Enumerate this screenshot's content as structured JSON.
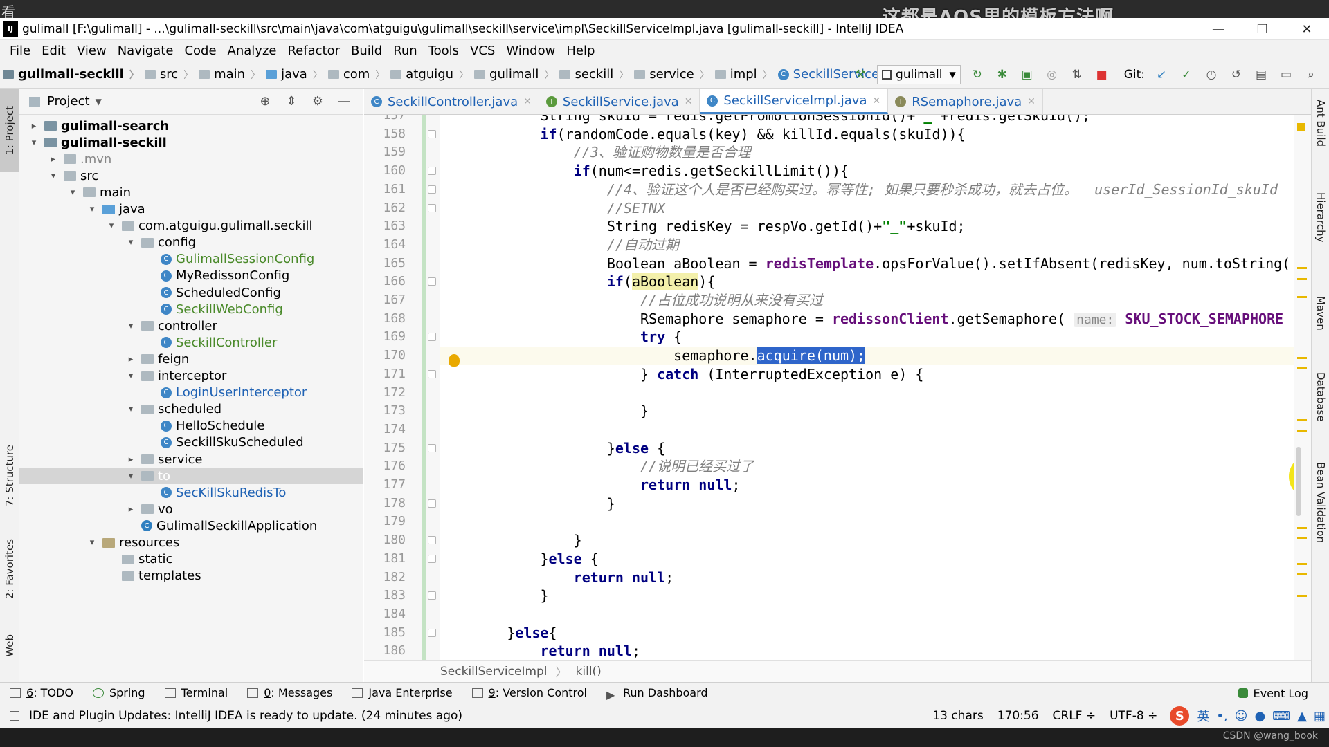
{
  "overlay": {
    "corner": "看",
    "caption": "这都是AQS里的模板方法啊"
  },
  "window": {
    "title": "gulimall [F:\\gulimall] - ...\\gulimall-seckill\\src\\main\\java\\com\\atguigu\\gulimall\\seckill\\service\\impl\\SeckillServiceImpl.java [gulimall-seckill] - IntelliJ IDEA",
    "logo": "IJ"
  },
  "menu": [
    "File",
    "Edit",
    "View",
    "Navigate",
    "Code",
    "Analyze",
    "Refactor",
    "Build",
    "Run",
    "Tools",
    "VCS",
    "Window",
    "Help"
  ],
  "breadcrumb": [
    "gulimall-seckill",
    "src",
    "main",
    "java",
    "com",
    "atguigu",
    "gulimall",
    "seckill",
    "service",
    "impl",
    "SeckillServiceImpl"
  ],
  "toolbar": {
    "run_config": "gulimall",
    "git_label": "Git:"
  },
  "project": {
    "title": "Project",
    "tree": [
      {
        "label": "gulimall-search",
        "level": 1,
        "arrow": "›",
        "type": "mod",
        "style": "bold"
      },
      {
        "label": "gulimall-seckill",
        "level": 1,
        "arrow": "⌄",
        "type": "mod",
        "style": "bold"
      },
      {
        "label": ".mvn",
        "level": 2,
        "arrow": "›",
        "type": "dir",
        "style": "gray"
      },
      {
        "label": "src",
        "level": 2,
        "arrow": "⌄",
        "type": "dir",
        "style": ""
      },
      {
        "label": "main",
        "level": 3,
        "arrow": "⌄",
        "type": "dir",
        "style": ""
      },
      {
        "label": "java",
        "level": 4,
        "arrow": "⌄",
        "type": "java",
        "style": ""
      },
      {
        "label": "com.atguigu.gulimall.seckill",
        "level": 5,
        "arrow": "⌄",
        "type": "dir",
        "style": ""
      },
      {
        "label": "config",
        "level": 6,
        "arrow": "⌄",
        "type": "dir",
        "style": ""
      },
      {
        "label": "GulimallSessionConfig",
        "level": 7,
        "arrow": "",
        "type": "class",
        "style": "green"
      },
      {
        "label": "MyRedissonConfig",
        "level": 7,
        "arrow": "",
        "type": "class",
        "style": ""
      },
      {
        "label": "ScheduledConfig",
        "level": 7,
        "arrow": "",
        "type": "class",
        "style": ""
      },
      {
        "label": "SeckillWebConfig",
        "level": 7,
        "arrow": "",
        "type": "class",
        "style": "green"
      },
      {
        "label": "controller",
        "level": 6,
        "arrow": "⌄",
        "type": "dir",
        "style": ""
      },
      {
        "label": "SeckillController",
        "level": 7,
        "arrow": "",
        "type": "class",
        "style": "green"
      },
      {
        "label": "feign",
        "level": 6,
        "arrow": "›",
        "type": "dir",
        "style": ""
      },
      {
        "label": "interceptor",
        "level": 6,
        "arrow": "⌄",
        "type": "dir",
        "style": ""
      },
      {
        "label": "LoginUserInterceptor",
        "level": 7,
        "arrow": "",
        "type": "class",
        "style": "blue"
      },
      {
        "label": "scheduled",
        "level": 6,
        "arrow": "⌄",
        "type": "dir",
        "style": ""
      },
      {
        "label": "HelloSchedule",
        "level": 7,
        "arrow": "",
        "type": "class",
        "style": ""
      },
      {
        "label": "SeckillSkuScheduled",
        "level": 7,
        "arrow": "",
        "type": "class",
        "style": ""
      },
      {
        "label": "service",
        "level": 6,
        "arrow": "›",
        "type": "dir",
        "style": ""
      },
      {
        "label": "to",
        "level": 6,
        "arrow": "⌄",
        "type": "dir",
        "style": "",
        "selected": true
      },
      {
        "label": "SecKillSkuRedisTo",
        "level": 7,
        "arrow": "",
        "type": "class",
        "style": "blue"
      },
      {
        "label": "vo",
        "level": 6,
        "arrow": "›",
        "type": "dir",
        "style": ""
      },
      {
        "label": "GulimallSeckillApplication",
        "level": 6,
        "arrow": "",
        "type": "app",
        "style": ""
      },
      {
        "label": "resources",
        "level": 4,
        "arrow": "⌄",
        "type": "res",
        "style": ""
      },
      {
        "label": "static",
        "level": 5,
        "arrow": "",
        "type": "dir",
        "style": ""
      },
      {
        "label": "templates",
        "level": 5,
        "arrow": "",
        "type": "dir",
        "style": ""
      }
    ]
  },
  "tabs": [
    {
      "label": "SeckillController.java",
      "icon": "C",
      "kind": "class",
      "active": false
    },
    {
      "label": "SeckillService.java",
      "icon": "I",
      "kind": "iface",
      "active": false
    },
    {
      "label": "SeckillServiceImpl.java",
      "icon": "C",
      "kind": "class",
      "active": true
    },
    {
      "label": "RSemaphore.java",
      "icon": "I",
      "kind": "lib",
      "active": false
    }
  ],
  "editor": {
    "current_line": 170,
    "lines": [
      {
        "n": 157,
        "html": "            <span>String skuId = redis.getPromotionSessionId()+</span><span class=\"str\">\"_\"</span><span>+redis.getSkuId();</span>"
      },
      {
        "n": 158,
        "html": "            <span class=\"kw\">if</span><span>(randomCode.equals(key) &amp;&amp; killId.equals(skuId)){</span>"
      },
      {
        "n": 159,
        "html": "                <span class=\"cm\">//3、验证购物数量是否合理</span>"
      },
      {
        "n": 160,
        "html": "                <span class=\"kw\">if</span><span>(num&lt;=redis.getSeckillLimit()){</span>"
      },
      {
        "n": 161,
        "html": "                    <span class=\"cm\">//4、验证这个人是否已经购买过。幂等性; 如果只要秒杀成功，就去占位。  userId_SessionId_skuId</span>"
      },
      {
        "n": 162,
        "html": "                    <span class=\"cm\">//SETNX</span>"
      },
      {
        "n": 163,
        "html": "                    <span>String redisKey = respVo.getId()+</span><span class=\"str\">\"_\"</span><span>+skuId;</span>"
      },
      {
        "n": 164,
        "html": "                    <span class=\"cm\">//自动过期</span>"
      },
      {
        "n": 165,
        "html": "                    <span>Boolean aBoolean = </span><span class=\"fld\">redisTemplate</span><span>.opsForValue().setIfAbsent(redisKey, num.toString(</span>"
      },
      {
        "n": 166,
        "html": "                    <span class=\"kw\">if</span><span>(</span><span class=\"hl\">aBoolean</span><span>){</span>"
      },
      {
        "n": 167,
        "html": "                        <span class=\"cm\">//占位成功说明从来没有买过</span>"
      },
      {
        "n": 168,
        "html": "                        <span>RSemaphore semaphore = </span><span class=\"fld\">redissonClient</span><span>.getSemaphore( </span><span class=\"hint\">name:</span><span class=\"fld\"> SKU_STOCK_SEMAPHORE</span>"
      },
      {
        "n": 169,
        "html": "                        <span class=\"kw\">try</span><span> {</span>"
      },
      {
        "n": 170,
        "html": "                            <span>semaphore.</span><span class=\"sel\">acquire(num);</span>"
      },
      {
        "n": 171,
        "html": "                        <span>} </span><span class=\"kw\">catch</span><span> (InterruptedException e) {</span>"
      },
      {
        "n": 172,
        "html": ""
      },
      {
        "n": 173,
        "html": "                        <span>}</span>"
      },
      {
        "n": 174,
        "html": ""
      },
      {
        "n": 175,
        "html": "                    <span>}</span><span class=\"kw\">else</span><span> {</span>"
      },
      {
        "n": 176,
        "html": "                        <span class=\"cm\">//说明已经买过了</span>"
      },
      {
        "n": 177,
        "html": "                        <span class=\"kw\">return null</span><span>;</span>"
      },
      {
        "n": 178,
        "html": "                    <span>}</span>"
      },
      {
        "n": 179,
        "html": ""
      },
      {
        "n": 180,
        "html": "                <span>}</span>"
      },
      {
        "n": 181,
        "html": "            <span>}</span><span class=\"kw\">else</span><span> {</span>"
      },
      {
        "n": 182,
        "html": "                <span class=\"kw\">return null</span><span>;</span>"
      },
      {
        "n": 183,
        "html": "            <span>}</span>"
      },
      {
        "n": 184,
        "html": ""
      },
      {
        "n": 185,
        "html": "        <span>}</span><span class=\"kw\">else</span><span>{</span>"
      },
      {
        "n": 186,
        "html": "            <span class=\"kw\">return null</span><span>;</span>"
      }
    ],
    "crumbs": [
      "SeckillServiceImpl",
      "kill()"
    ]
  },
  "left_tools": [
    "1: Project",
    "7: Structure",
    "2: Favorites",
    "Web"
  ],
  "right_tools": [
    "Ant Build",
    "Hierarchy",
    "Maven",
    "Database",
    "Bean Validation"
  ],
  "bottom_tools": [
    {
      "num": "6",
      "label": "TODO"
    },
    {
      "num": "",
      "label": "Spring"
    },
    {
      "num": "",
      "label": "Terminal"
    },
    {
      "num": "0",
      "label": "Messages"
    },
    {
      "num": "",
      "label": "Java Enterprise"
    },
    {
      "num": "9",
      "label": "Version Control"
    },
    {
      "num": "",
      "label": "Run Dashboard"
    }
  ],
  "event_log": "Event Log",
  "status": {
    "message": "IDE and Plugin Updates: IntelliJ IDEA is ready to update. (24 minutes ago)",
    "chars": "13 chars",
    "position": "170:56",
    "line_sep": "CRLF ÷",
    "encoding": "UTF-8 ÷",
    "ime_lang": "英"
  },
  "watermark": "CSDN @wang_book"
}
